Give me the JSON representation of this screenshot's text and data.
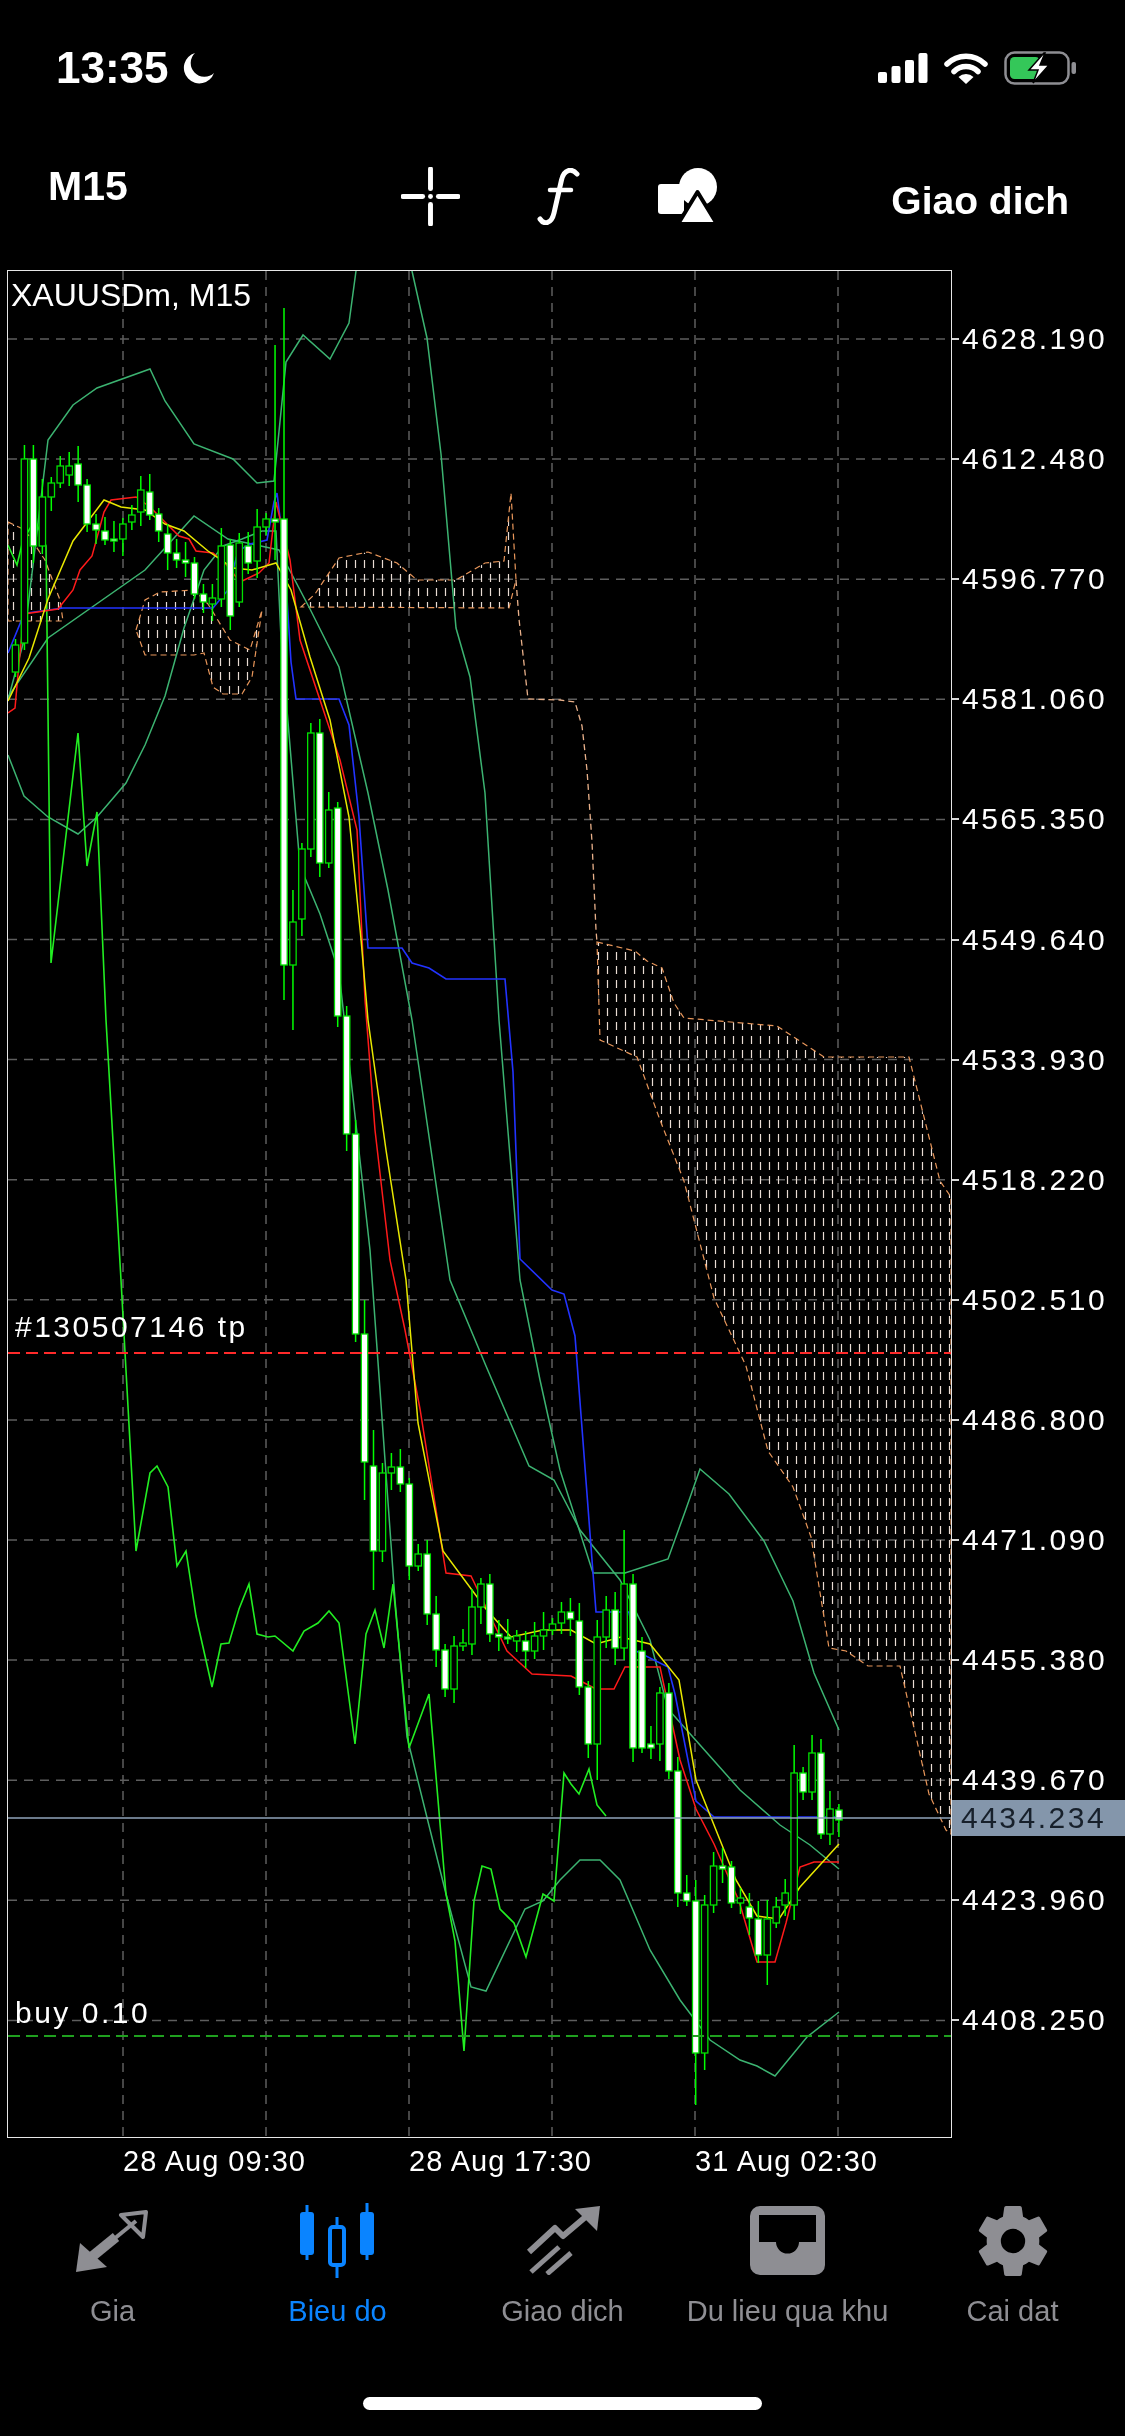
{
  "status_bar": {
    "time": "13:35"
  },
  "toolbar": {
    "timeframe": "M15",
    "trade_button": "Giao dich"
  },
  "chart": {
    "symbol_label": "XAUUSDm, M15",
    "price_labels": [
      "4628.190",
      "4612.480",
      "4596.770",
      "4581.060",
      "4565.350",
      "4549.640",
      "4533.930",
      "4518.220",
      "4502.510",
      "4486.800",
      "4471.090",
      "4455.380",
      "4439.670",
      "4423.960",
      "4408.250"
    ],
    "current_price": "4434.234",
    "order_lines": [
      {
        "kind": "take_profit",
        "label": "#130507146 tp"
      },
      {
        "kind": "buy",
        "label": "buy 0.10"
      }
    ],
    "time_labels": [
      "28 Aug 09:30",
      "28 Aug 17:30",
      "31 Aug 02:30"
    ]
  },
  "tab_bar": {
    "tabs": [
      {
        "label": "Gia",
        "selected": false
      },
      {
        "label": "Bieu do",
        "selected": true
      },
      {
        "label": "Giao dich",
        "selected": false
      },
      {
        "label": "Du lieu qua khu",
        "selected": false
      },
      {
        "label": "Cai dat",
        "selected": false
      }
    ]
  }
}
